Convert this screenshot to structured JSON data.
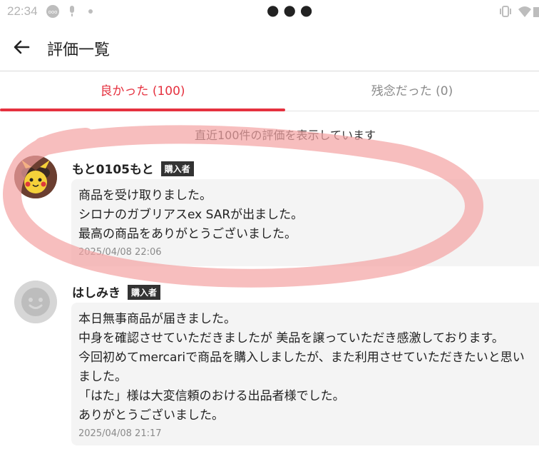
{
  "status_bar": {
    "time": "22:34",
    "icons": [
      "ooo-icon",
      "mic-icon",
      "dot-icon",
      "vibrate-icon",
      "wifi-icon",
      "battery-icon"
    ]
  },
  "header": {
    "title": "評価一覧",
    "back_icon": "arrow-left-icon"
  },
  "tabs": [
    {
      "label": "良かった (100)",
      "active": true
    },
    {
      "label": "残念だった (0)",
      "active": false
    }
  ],
  "notice": "直近100件の評価を表示しています",
  "colors": {
    "accent": "#e5313f",
    "bubble": "#f4f4f4",
    "badge": "#333333",
    "annotation": "#f4a3a3"
  },
  "reviews": [
    {
      "name": "もと0105もと",
      "badge": "購入者",
      "avatar": "pikachu-avatar",
      "lines": [
        "商品を受け取りました。",
        "シロナのガブリアスex SARが出ました。",
        "最高の商品をありがとうございました。"
      ],
      "date": "2025/04/08 22:06"
    },
    {
      "name": "はしみき",
      "badge": "購入者",
      "avatar": "default-avatar",
      "lines": [
        "本日無事商品が届きました。",
        "中身を確認させていただきましたが 美品を譲っていただき感激しております。",
        "今回初めてmercariで商品を購入しましたが、また利用させていただきたいと思い",
        "ました。",
        "「はた」様は大変信頼のおける出品者様でした。",
        "ありがとうございました。"
      ],
      "date": "2025/04/08 21:17"
    }
  ]
}
